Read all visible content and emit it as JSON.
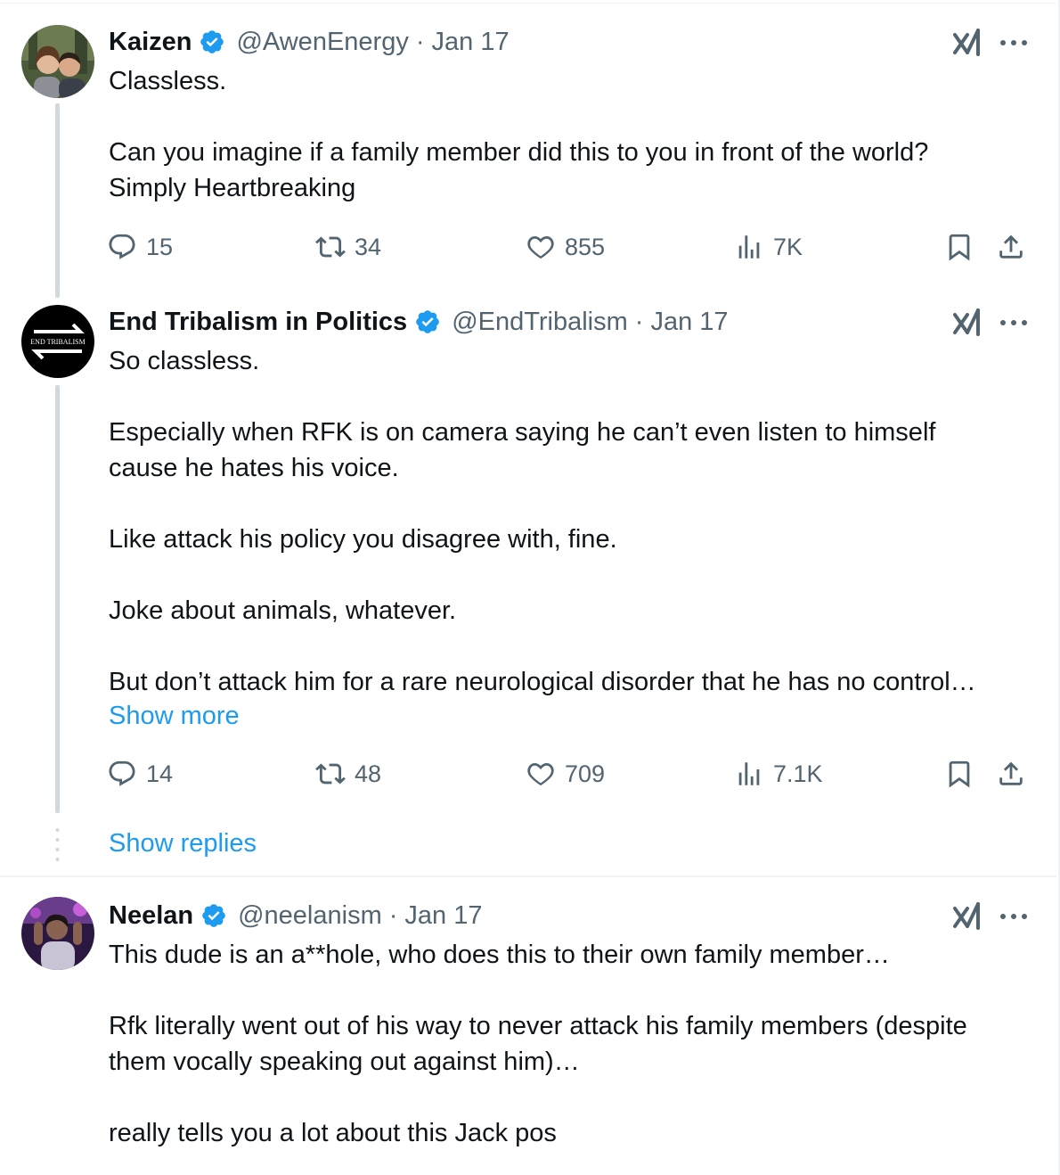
{
  "accent_color": "#1d9bf0",
  "icons": {
    "verified": "verified-badge-icon",
    "grok": "grok-icon",
    "more": "more-icon",
    "reply": "reply-icon",
    "retweet": "retweet-icon",
    "like": "heart-icon",
    "views": "views-icon",
    "bookmark": "bookmark-icon",
    "share": "share-icon"
  },
  "tweets": [
    {
      "name": "Kaizen",
      "handle": "@AwenEnergy",
      "separator": "·",
      "date": "Jan 17",
      "lines": [
        "Classless.",
        "",
        "Can you imagine if a family member did this to you in front of the world?",
        "Simply Heartbreaking"
      ],
      "stats": {
        "replies": "15",
        "retweets": "34",
        "likes": "855",
        "views": "7K"
      }
    },
    {
      "name": "End Tribalism in Politics",
      "handle": "@EndTribalism",
      "separator": "·",
      "date": "Jan 17",
      "avatar_text": "END TRIBALISM",
      "lines": [
        "So classless.",
        "",
        "Especially when RFK is on camera saying he can’t even listen to himself",
        "cause he hates his voice.",
        "",
        "Like attack his policy you disagree with, fine.",
        "",
        "Joke about animals, whatever.",
        "",
        "But don’t attack him for a rare neurological disorder that he has no control…"
      ],
      "show_more": "Show more",
      "stats": {
        "replies": "14",
        "retweets": "48",
        "likes": "709",
        "views": "7.1K"
      }
    },
    {
      "name": "Neelan",
      "handle": "@neelanism",
      "separator": "·",
      "date": "Jan 17",
      "lines": [
        "This dude is an a**hole, who does this to their own family member…",
        "",
        "Rfk literally went out of his way to never attack his family members (despite",
        "them vocally speaking out against him)…",
        "",
        "really tells you a lot about this Jack pos"
      ]
    }
  ],
  "show_replies": "Show replies"
}
